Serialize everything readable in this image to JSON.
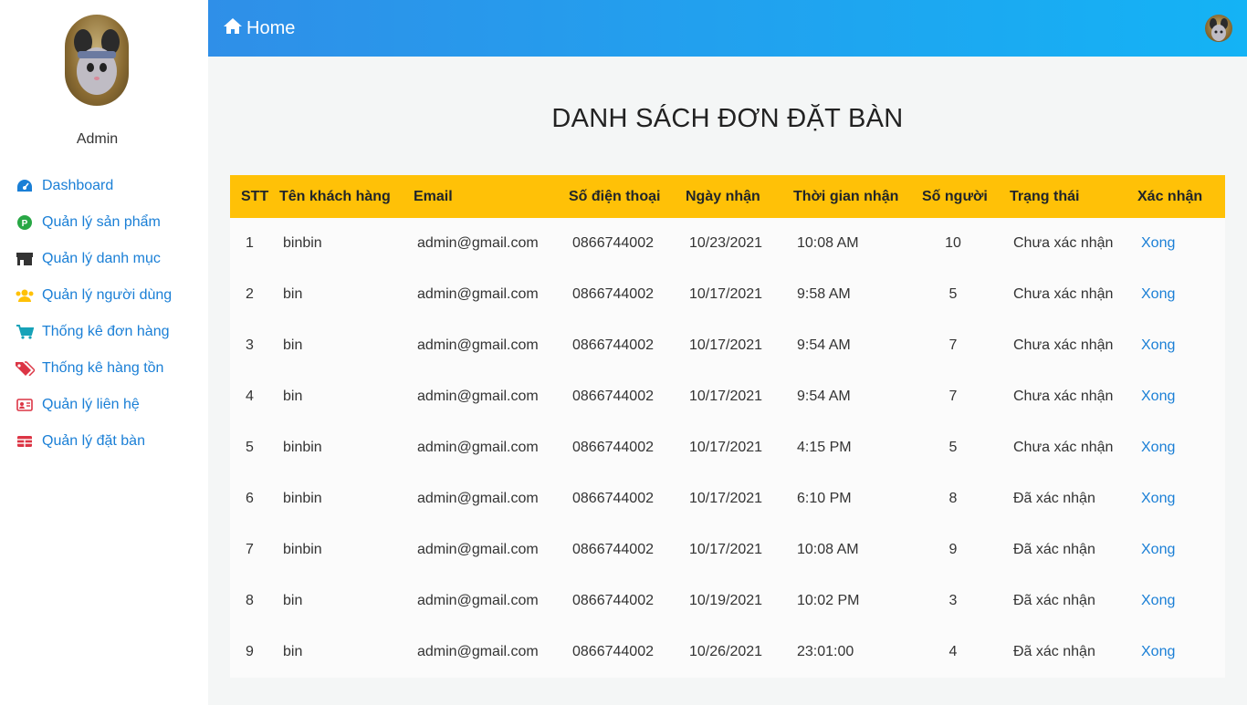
{
  "sidebar": {
    "user_name": "Admin",
    "items": [
      {
        "label": "Dashboard",
        "icon": "dashboard-icon",
        "color": "#1a7fd6"
      },
      {
        "label": "Quản lý sản phẩm",
        "icon": "product-icon",
        "color": "#28a745"
      },
      {
        "label": "Quản lý danh mục",
        "icon": "store-icon",
        "color": "#333333"
      },
      {
        "label": "Quản lý người dùng",
        "icon": "users-icon",
        "color": "#ffc107"
      },
      {
        "label": "Thống kê đơn hàng",
        "icon": "cart-icon",
        "color": "#17a2b8"
      },
      {
        "label": "Thống kê hàng tồn",
        "icon": "tags-icon",
        "color": "#dc3545"
      },
      {
        "label": "Quản lý liên hệ",
        "icon": "contact-card-icon",
        "color": "#dc3545"
      },
      {
        "label": "Quản lý đặt bàn",
        "icon": "table-icon",
        "color": "#dc3545"
      }
    ]
  },
  "topbar": {
    "home_label": "Home"
  },
  "page": {
    "title": "DANH SÁCH ĐƠN ĐẶT BÀN"
  },
  "table": {
    "headers": [
      "STT",
      "Tên khách hàng",
      "Email",
      "Số điện thoại",
      "Ngày nhận",
      "Thời gian nhận",
      "Số người",
      "Trạng thái",
      "Xác nhận"
    ],
    "rows": [
      {
        "stt": "1",
        "name": "binbin",
        "email": "admin@gmail.com",
        "phone": "0866744002",
        "date": "10/23/2021",
        "time": "10:08 AM",
        "people": "10",
        "status": "Chưa xác nhận",
        "action": "Xong"
      },
      {
        "stt": "2",
        "name": "bin",
        "email": "admin@gmail.com",
        "phone": "0866744002",
        "date": "10/17/2021",
        "time": "9:58 AM",
        "people": "5",
        "status": "Chưa xác nhận",
        "action": "Xong"
      },
      {
        "stt": "3",
        "name": "bin",
        "email": "admin@gmail.com",
        "phone": "0866744002",
        "date": "10/17/2021",
        "time": "9:54 AM",
        "people": "7",
        "status": "Chưa xác nhận",
        "action": "Xong"
      },
      {
        "stt": "4",
        "name": "bin",
        "email": "admin@gmail.com",
        "phone": "0866744002",
        "date": "10/17/2021",
        "time": "9:54 AM",
        "people": "7",
        "status": "Chưa xác nhận",
        "action": "Xong"
      },
      {
        "stt": "5",
        "name": "binbin",
        "email": "admin@gmail.com",
        "phone": "0866744002",
        "date": "10/17/2021",
        "time": "4:15 PM",
        "people": "5",
        "status": "Chưa xác nhận",
        "action": "Xong"
      },
      {
        "stt": "6",
        "name": "binbin",
        "email": "admin@gmail.com",
        "phone": "0866744002",
        "date": "10/17/2021",
        "time": "6:10 PM",
        "people": "8",
        "status": "Đã xác nhận",
        "action": "Xong"
      },
      {
        "stt": "7",
        "name": "binbin",
        "email": "admin@gmail.com",
        "phone": "0866744002",
        "date": "10/17/2021",
        "time": "10:08 AM",
        "people": "9",
        "status": "Đã xác nhận",
        "action": "Xong"
      },
      {
        "stt": "8",
        "name": "bin",
        "email": "admin@gmail.com",
        "phone": "0866744002",
        "date": "10/19/2021",
        "time": "10:02 PM",
        "people": "3",
        "status": "Đã xác nhận",
        "action": "Xong"
      },
      {
        "stt": "9",
        "name": "bin",
        "email": "admin@gmail.com",
        "phone": "0866744002",
        "date": "10/26/2021",
        "time": "23:01:00",
        "people": "4",
        "status": "Đã xác nhận",
        "action": "Xong"
      }
    ]
  },
  "colors": {
    "accent": "#1a7fd6",
    "header_row": "#ffc107",
    "topbar_start": "#2f8fe8",
    "topbar_end": "#14b3f5"
  }
}
